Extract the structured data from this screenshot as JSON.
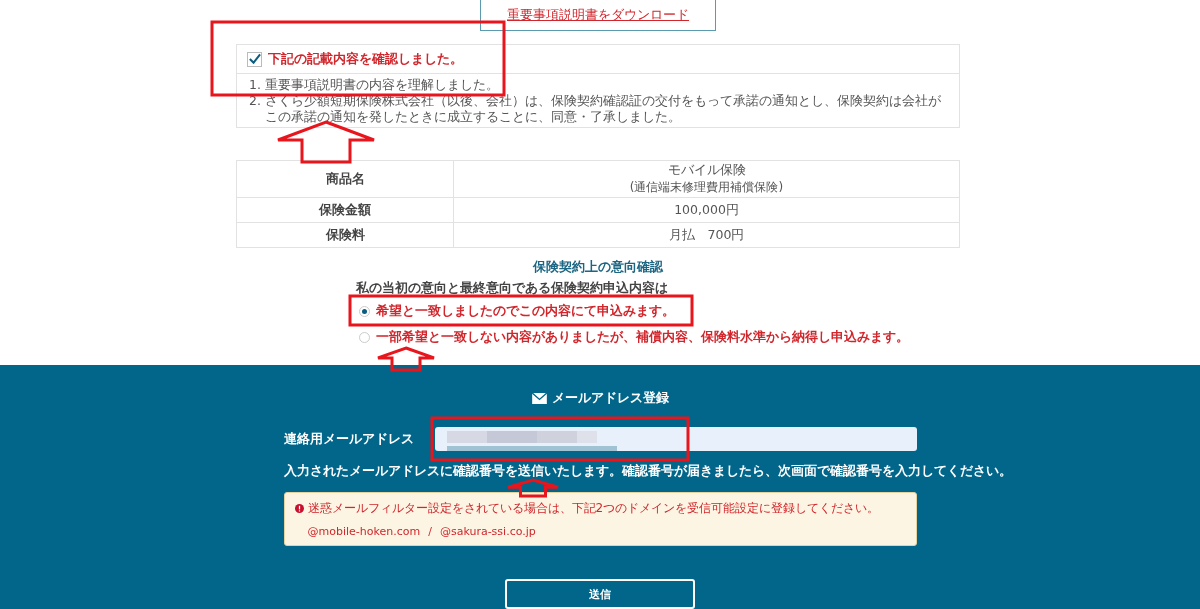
{
  "download_link": {
    "label": "重要事項説明書をダウンロード"
  },
  "confirmation": {
    "label": "下記の記載内容を確認しました。",
    "checked": true,
    "items": [
      {
        "number": "1.",
        "text": "重要事項説明書の内容を理解しました。"
      },
      {
        "number": "2.",
        "text": "さくら少額短期保険株式会社（以後、会社）は、保険契約確認証の交付をもって承諾の通知とし、保険契約は会社がこの承諾の通知を発したときに成立することに、同意・了承しました。"
      }
    ]
  },
  "product_table": {
    "rows": [
      {
        "label": "商品名",
        "value": "モバイル保険",
        "sub": "(通信端末修理費用補償保険)"
      },
      {
        "label": "保険金額",
        "value": "100,000円"
      },
      {
        "label": "保険料",
        "value": "月払　700円"
      }
    ]
  },
  "intention": {
    "title": "保険契約上の意向確認",
    "question": "私の当初の意向と最終意向である保険契約申込内容は",
    "options": [
      {
        "label": "希望と一致しましたのでこの内容にて申込みます。",
        "selected": true
      },
      {
        "label": "一部希望と一致しない内容がありましたが、補償内容、保険料水準から納得し申込みます。",
        "selected": false
      }
    ]
  },
  "email": {
    "title": "メールアドレス登録",
    "field_label": "連絡用メールアドレス",
    "note": "入力されたメールアドレスに確認番号を送信いたします。確認番号が届きましたら、次画面で確認番号を入力してください。",
    "warning": "迷惑メールフィルター設定をされている場合は、下記2つのドメインを受信可能設定に登録してください。",
    "domains": [
      "@mobile-hoken.com",
      "/",
      "@sakura-ssi.co.jp"
    ],
    "submit": "送信"
  },
  "annotations": [
    {
      "kind": "frame"
    },
    {
      "kind": "arrow"
    },
    {
      "kind": "frame"
    },
    {
      "kind": "arrow"
    },
    {
      "kind": "frame"
    },
    {
      "kind": "arrow"
    }
  ]
}
